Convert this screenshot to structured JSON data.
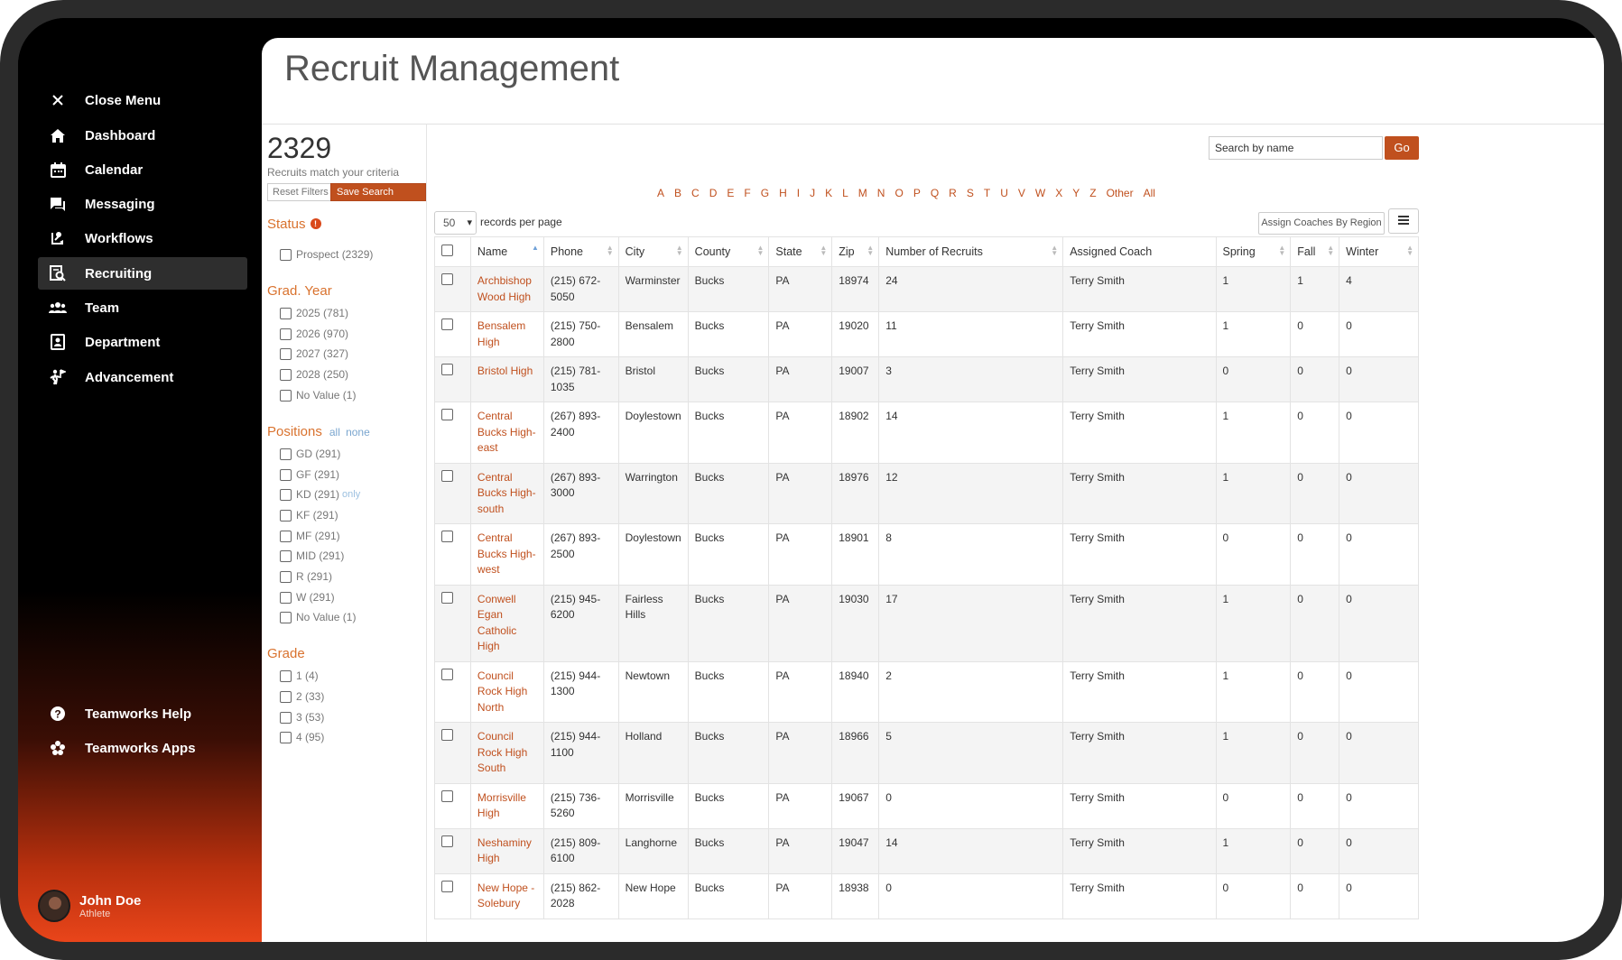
{
  "nav": {
    "close_label": "Close Menu",
    "items": [
      {
        "label": "Dashboard",
        "icon": "home-icon"
      },
      {
        "label": "Calendar",
        "icon": "calendar-icon"
      },
      {
        "label": "Messaging",
        "icon": "chat-icon"
      },
      {
        "label": "Workflows",
        "icon": "workflow-icon"
      },
      {
        "label": "Recruiting",
        "icon": "recruiting-icon",
        "active": true
      },
      {
        "label": "Team",
        "icon": "team-icon"
      },
      {
        "label": "Department",
        "icon": "department-icon"
      },
      {
        "label": "Advancement",
        "icon": "advancement-icon"
      }
    ],
    "help_label": "Teamworks Help",
    "apps_label": "Teamworks Apps"
  },
  "user": {
    "name": "John Doe",
    "role": "Athlete"
  },
  "page": {
    "title": "Recruit Management"
  },
  "filters": {
    "count": "2329",
    "count_sub": "Recruits match your criteria",
    "reset_label": "Reset Filters",
    "save_label": "Save Search Options",
    "status": {
      "title": "Status",
      "options": [
        "Prospect (2329)"
      ]
    },
    "grad_year": {
      "title": "Grad. Year",
      "options": [
        "2025 (781)",
        "2026 (970)",
        "2027 (327)",
        "2028 (250)",
        "No Value (1)"
      ]
    },
    "positions": {
      "title": "Positions",
      "all": "all",
      "none": "none",
      "only": "only",
      "options": [
        "GD (291)",
        "GF (291)",
        "KD (291)",
        "KF (291)",
        "MF (291)",
        "MID (291)",
        "R (291)",
        "W (291)",
        "No Value (1)"
      ]
    },
    "grade": {
      "title": "Grade",
      "options": [
        "1 (4)",
        "2 (33)",
        "3 (53)",
        "4 (95)"
      ]
    }
  },
  "search": {
    "placeholder": "Search by name",
    "go_label": "Go"
  },
  "alphabet": [
    "A",
    "B",
    "C",
    "D",
    "E",
    "F",
    "G",
    "H",
    "I",
    "J",
    "K",
    "L",
    "M",
    "N",
    "O",
    "P",
    "Q",
    "R",
    "S",
    "T",
    "U",
    "V",
    "W",
    "X",
    "Y",
    "Z",
    "Other",
    "All"
  ],
  "records": {
    "per_page": "50",
    "label": "records per page"
  },
  "assign_label": "Assign Coaches By Region",
  "table": {
    "headers": [
      "Name",
      "Phone",
      "City",
      "County",
      "State",
      "Zip",
      "Number of Recruits",
      "Assigned Coach",
      "Spring",
      "Fall",
      "Winter"
    ],
    "rows": [
      {
        "name": "Archbishop Wood High",
        "phone": "(215) 672-5050",
        "city": "Warminster",
        "county": "Bucks",
        "state": "PA",
        "zip": "18974",
        "recruits": "24",
        "coach": "Terry Smith",
        "spring": "1",
        "fall": "1",
        "winter": "4"
      },
      {
        "name": "Bensalem High",
        "phone": "(215) 750-2800",
        "city": "Bensalem",
        "county": "Bucks",
        "state": "PA",
        "zip": "19020",
        "recruits": "11",
        "coach": "Terry Smith",
        "spring": "1",
        "fall": "0",
        "winter": "0"
      },
      {
        "name": "Bristol High",
        "phone": "(215) 781-1035",
        "city": "Bristol",
        "county": "Bucks",
        "state": "PA",
        "zip": "19007",
        "recruits": "3",
        "coach": "Terry Smith",
        "spring": "0",
        "fall": "0",
        "winter": "0"
      },
      {
        "name": "Central Bucks High-east",
        "phone": "(267) 893-2400",
        "city": "Doylestown",
        "county": "Bucks",
        "state": "PA",
        "zip": "18902",
        "recruits": "14",
        "coach": "Terry Smith",
        "spring": "1",
        "fall": "0",
        "winter": "0"
      },
      {
        "name": "Central Bucks High-south",
        "phone": "(267) 893-3000",
        "city": "Warrington",
        "county": "Bucks",
        "state": "PA",
        "zip": "18976",
        "recruits": "12",
        "coach": "Terry Smith",
        "spring": "1",
        "fall": "0",
        "winter": "0"
      },
      {
        "name": "Central Bucks High-west",
        "phone": "(267) 893-2500",
        "city": "Doylestown",
        "county": "Bucks",
        "state": "PA",
        "zip": "18901",
        "recruits": "8",
        "coach": "Terry Smith",
        "spring": "0",
        "fall": "0",
        "winter": "0"
      },
      {
        "name": "Conwell Egan Catholic High",
        "phone": "(215) 945-6200",
        "city": "Fairless Hills",
        "county": "Bucks",
        "state": "PA",
        "zip": "19030",
        "recruits": "17",
        "coach": "Terry Smith",
        "spring": "1",
        "fall": "0",
        "winter": "0"
      },
      {
        "name": "Council Rock High North",
        "phone": "(215) 944-1300",
        "city": "Newtown",
        "county": "Bucks",
        "state": "PA",
        "zip": "18940",
        "recruits": "2",
        "coach": "Terry Smith",
        "spring": "1",
        "fall": "0",
        "winter": "0"
      },
      {
        "name": "Council Rock High South",
        "phone": "(215) 944-1100",
        "city": "Holland",
        "county": "Bucks",
        "state": "PA",
        "zip": "18966",
        "recruits": "5",
        "coach": "Terry Smith",
        "spring": "1",
        "fall": "0",
        "winter": "0"
      },
      {
        "name": "Morrisville High",
        "phone": "(215) 736-5260",
        "city": "Morrisville",
        "county": "Bucks",
        "state": "PA",
        "zip": "19067",
        "recruits": "0",
        "coach": "Terry Smith",
        "spring": "0",
        "fall": "0",
        "winter": "0"
      },
      {
        "name": "Neshaminy High",
        "phone": "(215) 809-6100",
        "city": "Langhorne",
        "county": "Bucks",
        "state": "PA",
        "zip": "19047",
        "recruits": "14",
        "coach": "Terry Smith",
        "spring": "1",
        "fall": "0",
        "winter": "0"
      },
      {
        "name": "New Hope - Solebury",
        "phone": "(215) 862-2028",
        "city": "New Hope",
        "county": "Bucks",
        "state": "PA",
        "zip": "18938",
        "recruits": "0",
        "coach": "Terry Smith",
        "spring": "0",
        "fall": "0",
        "winter": "0"
      }
    ]
  }
}
